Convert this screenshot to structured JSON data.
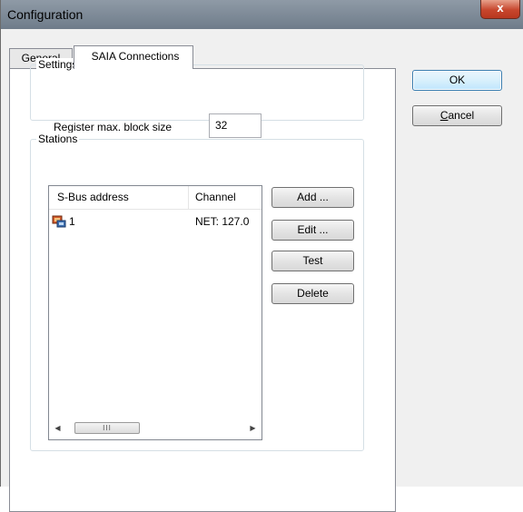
{
  "window": {
    "title": "Configuration",
    "close_label": "x"
  },
  "tabs": [
    {
      "label": "General"
    },
    {
      "label": "SAIA Connections"
    }
  ],
  "settings": {
    "group_label": "Settings",
    "register_label": "Register max. block size",
    "register_value": "32"
  },
  "stations": {
    "group_label": "Stations",
    "columns": [
      "S-Bus address",
      "Channel"
    ],
    "rows": [
      {
        "address": "1",
        "channel": "NET: 127.0",
        "icon": "station-icon"
      }
    ],
    "scroll_grip": "III"
  },
  "buttons": {
    "add": "Add ...",
    "edit": "Edit ...",
    "test": "Test",
    "delete": "Delete",
    "ok": "OK",
    "cancel_mnemonic": "C",
    "cancel_rest": "ancel"
  }
}
